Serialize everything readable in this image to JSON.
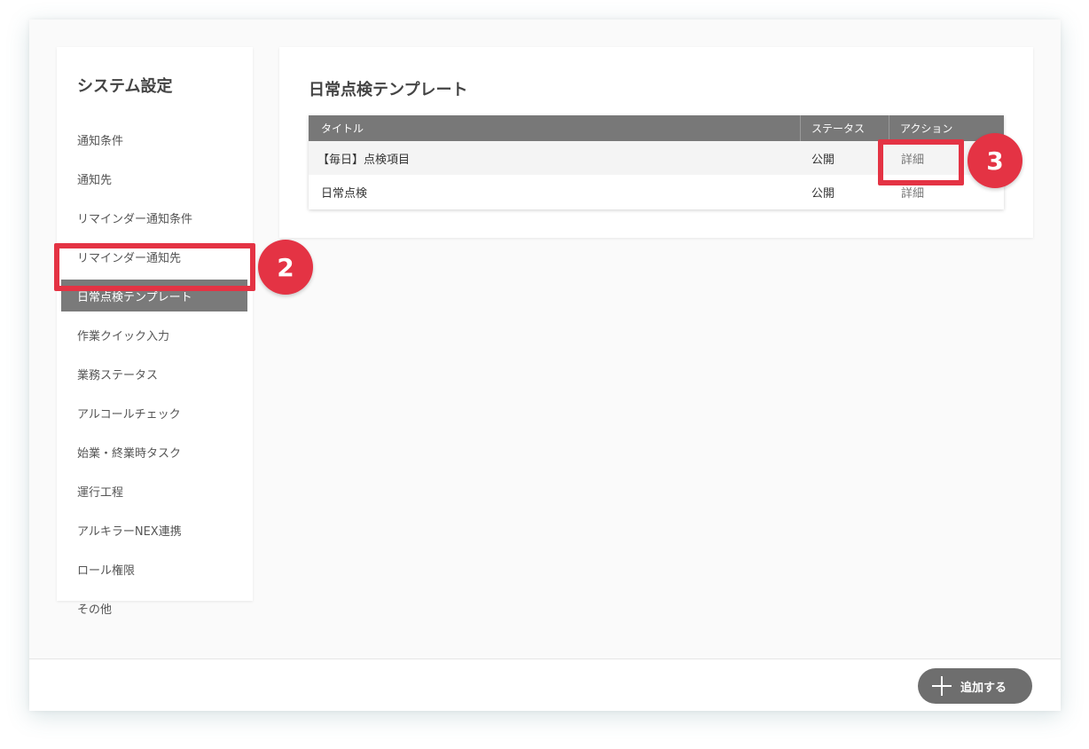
{
  "sidebar": {
    "title": "システム設定",
    "items": [
      {
        "label": "通知条件"
      },
      {
        "label": "通知先"
      },
      {
        "label": "リマインダー通知条件"
      },
      {
        "label": "リマインダー通知先"
      },
      {
        "label": "日常点検テンプレート",
        "active": true
      },
      {
        "label": "作業クイック入力"
      },
      {
        "label": "業務ステータス"
      },
      {
        "label": "アルコールチェック"
      },
      {
        "label": "始業・終業時タスク"
      },
      {
        "label": "運行工程"
      },
      {
        "label": "アルキラーNEX連携"
      },
      {
        "label": "ロール権限"
      },
      {
        "label": "その他"
      }
    ]
  },
  "callouts": {
    "sidebar_step": "2",
    "table_step": "3",
    "color": "#e43344"
  },
  "main": {
    "title": "日常点検テンプレート",
    "table": {
      "columns": [
        "タイトル",
        "ステータス",
        "アクション"
      ],
      "rows": [
        {
          "title": "【毎日】点検項目",
          "status": "公開",
          "action": "詳細"
        },
        {
          "title": "日常点検",
          "status": "公開",
          "action": "詳細"
        }
      ]
    }
  },
  "footer": {
    "add_label": "追加する",
    "add_icon": "plus-icon"
  }
}
